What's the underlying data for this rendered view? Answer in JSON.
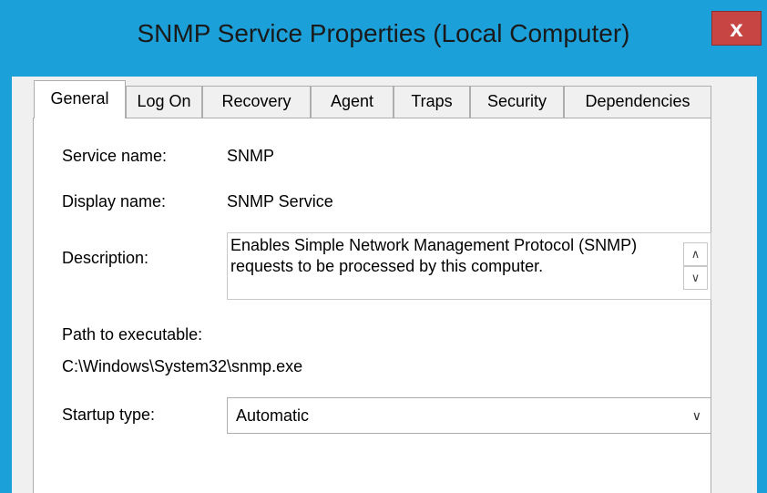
{
  "window": {
    "title": "SNMP Service Properties (Local Computer)",
    "close_label": "x"
  },
  "tabs": [
    {
      "label": "General",
      "active": true
    },
    {
      "label": "Log On",
      "active": false
    },
    {
      "label": "Recovery",
      "active": false
    },
    {
      "label": "Agent",
      "active": false
    },
    {
      "label": "Traps",
      "active": false
    },
    {
      "label": "Security",
      "active": false
    },
    {
      "label": "Dependencies",
      "active": false
    }
  ],
  "general": {
    "service_name_label": "Service name:",
    "service_name_value": "SNMP",
    "display_name_label": "Display name:",
    "display_name_value": "SNMP Service",
    "description_label": "Description:",
    "description_value": "Enables Simple Network Management Protocol (SNMP) requests to be processed by this computer.",
    "path_label": "Path to executable:",
    "path_value": "C:\\Windows\\System32\\snmp.exe",
    "startup_label": "Startup type:",
    "startup_value": "Automatic"
  },
  "colors": {
    "title_bar": "#1ba0da",
    "close_button": "#c74643",
    "dialog_background": "#f0f0f0"
  },
  "icons": {
    "scroll_up": "chevron-up-icon",
    "scroll_down": "chevron-down-icon",
    "dropdown": "chevron-down-icon"
  }
}
